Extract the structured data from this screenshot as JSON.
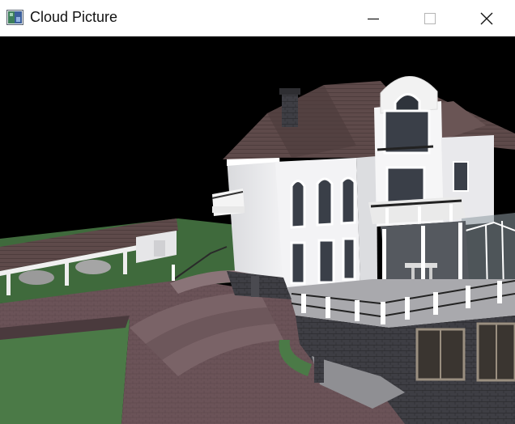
{
  "window": {
    "title": "Cloud Picture",
    "icons": {
      "app": "app-image-icon",
      "minimize": "minimize-icon",
      "maximize": "maximize-icon",
      "close": "close-icon"
    }
  },
  "viewport": {
    "content": "3d-house-render",
    "background": "#000000"
  }
}
